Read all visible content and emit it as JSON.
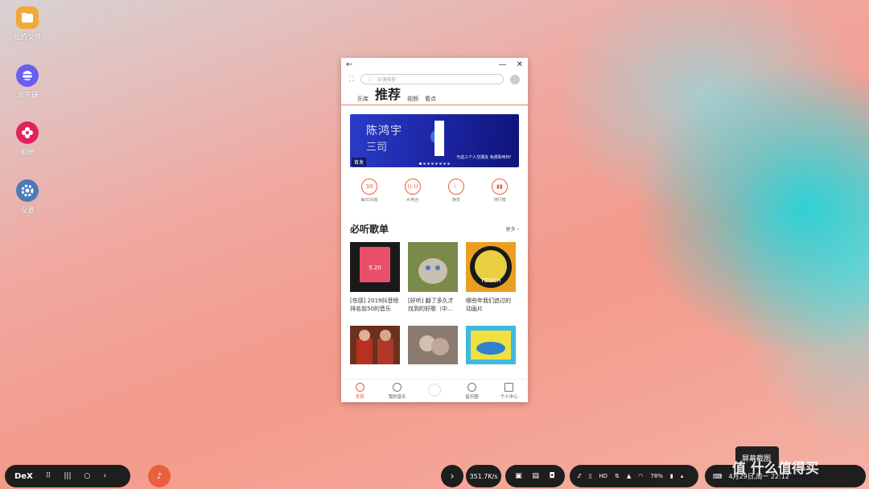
{
  "desktop": {
    "icons": [
      {
        "label": "我的文件",
        "icon": "folder-icon",
        "color": "#f2a83a"
      },
      {
        "label": "浏览器",
        "icon": "browser-planet-icon",
        "color": "#6a5ef0"
      },
      {
        "label": "相册",
        "icon": "gallery-flower-icon",
        "color": "#e0245e"
      },
      {
        "label": "设置",
        "icon": "gear-icon",
        "color": "#4a7ab8"
      }
    ]
  },
  "app": {
    "search_placeholder": "沙漠骆驼",
    "tabs": [
      "乐库",
      "推荐",
      "视频",
      "看点"
    ],
    "active_tab": "推荐",
    "banner": {
      "title_line1": "陈鸿宇",
      "title_line2": "三司",
      "caption": "与这三个人交朋友  免费聆听EP",
      "tag": "首发",
      "slide_count": 8
    },
    "quick_links": [
      {
        "label": "每日30首",
        "icon": "calendar-30-icon",
        "glyph": "30"
      },
      {
        "label": "AI电台",
        "icon": "radio-icon",
        "glyph": "((·))"
      },
      {
        "label": "晚安",
        "icon": "moon-icon",
        "glyph": "☾"
      },
      {
        "label": "排行榜",
        "icon": "chart-icon",
        "glyph": "▮▮"
      }
    ],
    "section": {
      "title": "必听歌单",
      "more": "更多",
      "playlists": [
        {
          "name": "[伤感] 2019抖音榜排名前50的音乐",
          "cover_text": "5.20"
        },
        {
          "name": "[好听] 翻了多久才找到的好歌（中...",
          "cover_text": ""
        },
        {
          "name": "哪些年我们追过的动画片",
          "cover_text": "TOUCH"
        }
      ]
    },
    "bottom_nav": [
      {
        "label": "发现",
        "icon": "discover-icon",
        "active": true
      },
      {
        "label": "我的音乐",
        "icon": "headphones-icon",
        "active": false
      },
      {
        "label": "",
        "icon": "play-icon",
        "active": false
      },
      {
        "label": "音乐圈",
        "icon": "smile-icon",
        "active": false
      },
      {
        "label": "个人中心",
        "icon": "grid-icon",
        "active": false
      }
    ],
    "accent": "#e8603c"
  },
  "taskbar": {
    "dex_label": "DeX",
    "net_speed": "351.7K/s",
    "battery": "78%",
    "datetime": "4月29日,周一 22:12",
    "tooltip": "屏幕截图",
    "watermark": "值 什么值得买"
  }
}
